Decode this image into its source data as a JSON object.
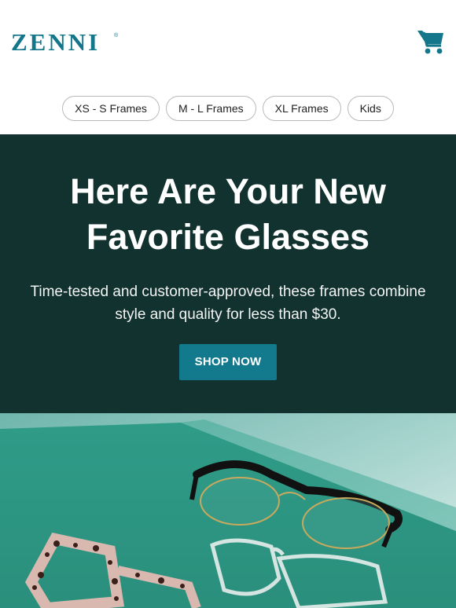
{
  "brand": {
    "logo_text": "ZENNI",
    "accent_color": "#137a8e",
    "hero_bg": "#12322f"
  },
  "header": {
    "cart_icon": "shopping-cart-icon"
  },
  "nav": {
    "pills": [
      "XS - S Frames",
      "M - L Frames",
      "XL Frames",
      "Kids"
    ]
  },
  "hero": {
    "headline": "Here Are Your New Favorite Glasses",
    "body": "Time-tested and customer-approved, these frames combine style and quality for less than $30.",
    "cta_label": "SHOP NOW"
  },
  "image": {
    "products": [
      "black-gold-browline-glasses",
      "pink-tortoise-glasses",
      "clear-glasses"
    ]
  }
}
